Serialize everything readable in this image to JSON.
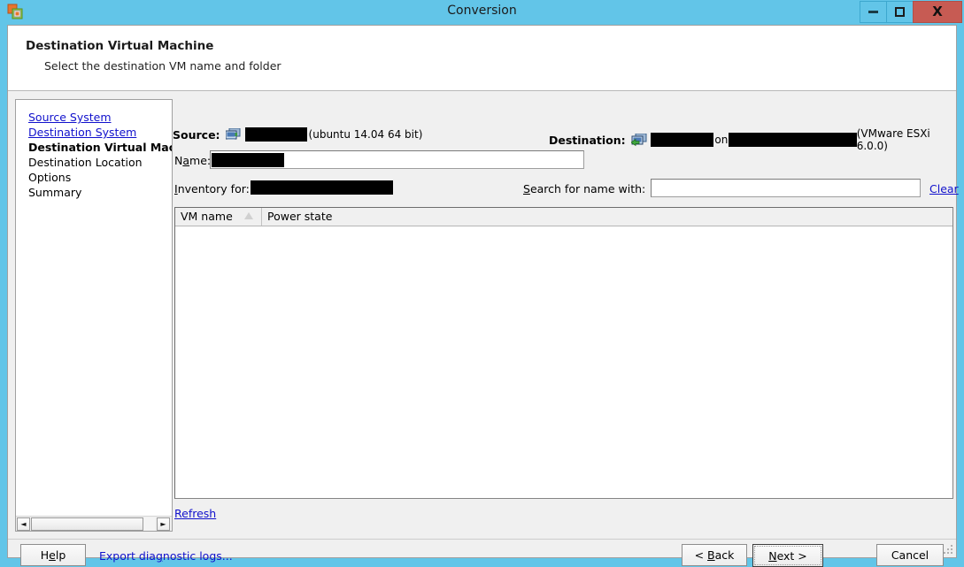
{
  "window": {
    "title": "Conversion",
    "app_icon": "converter-icon",
    "controls": {
      "minimize": "minimize-icon",
      "maximize": "maximize-icon",
      "close": "X"
    }
  },
  "header": {
    "title": "Destination Virtual Machine",
    "subtitle": "Select the destination VM name and folder"
  },
  "sidebar": {
    "items": [
      {
        "label": "Source System",
        "state": "link"
      },
      {
        "label": "Destination System",
        "state": "link"
      },
      {
        "label": "Destination Virtual Machi",
        "state": "current"
      },
      {
        "label": "Destination Location",
        "state": "plain"
      },
      {
        "label": "Options",
        "state": "plain"
      },
      {
        "label": "Summary",
        "state": "plain"
      }
    ],
    "scrollbar": {
      "left_arrow": "◄",
      "right_arrow": "►"
    }
  },
  "main": {
    "source": {
      "label": "Source:",
      "icon": "source-computer-icon",
      "name_value": "",
      "os": "(ubuntu 14.04 64 bit)"
    },
    "destination": {
      "label": "Destination:",
      "icon": "destination-host-icon",
      "vm_value": "",
      "connector": "on",
      "host_value": "",
      "product": "(VMware ESXi 6.0.0)"
    },
    "name_row": {
      "label_pre": "N",
      "label_accel": "a",
      "label_post": "me:",
      "value": ""
    },
    "inventory_row": {
      "label_accel": "I",
      "label_post": "nventory for:",
      "value": ""
    },
    "search_row": {
      "label_accel": "S",
      "label_post": "earch for name with:",
      "value": "",
      "placeholder": "",
      "clear_label": "Clear"
    },
    "list": {
      "columns": [
        {
          "label": "VM name",
          "sorted": true,
          "sort_dir": "asc"
        },
        {
          "label": "Power state",
          "sorted": false
        }
      ],
      "rows": []
    },
    "refresh": {
      "accel": "R",
      "post": "efresh"
    }
  },
  "footer": {
    "help": {
      "pre": "H",
      "accel": "e",
      "post": "lp"
    },
    "export_logs": {
      "pre": "Export dia",
      "accel": "g",
      "post": "nostic logs..."
    },
    "back": {
      "pre": "< ",
      "accel": "B",
      "post": "ack"
    },
    "next": {
      "accel": "N",
      "post": "ext >"
    },
    "cancel": {
      "label": "Cancel"
    }
  },
  "colors": {
    "window_chrome": "#62c5e8",
    "close_button": "#c75b53",
    "link": "#1111cc",
    "panel": "#f0f0f0"
  }
}
